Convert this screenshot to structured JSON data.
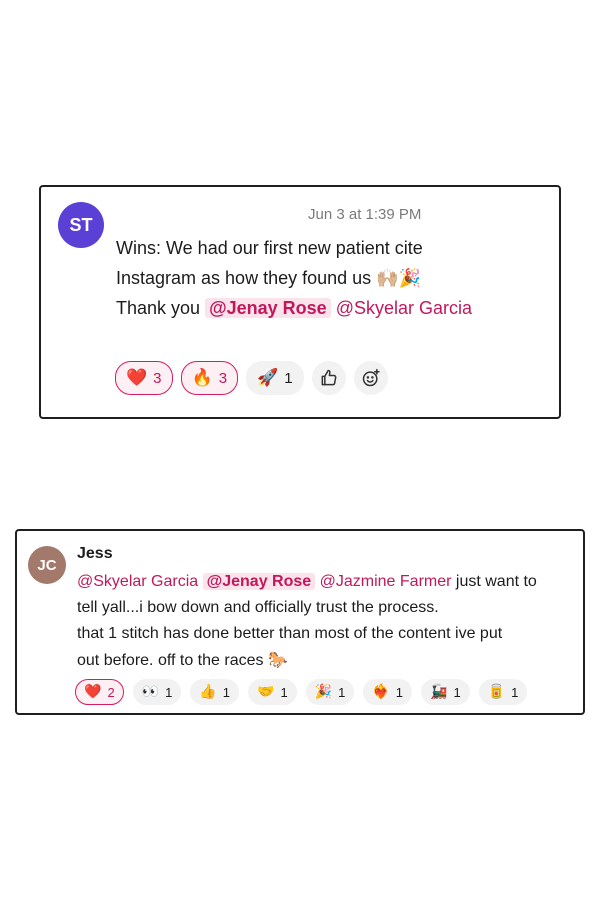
{
  "card1": {
    "avatar_initials": "ST",
    "timestamp": "Jun 3 at 1:39 PM",
    "line1": "Wins: We had our first new patient cite",
    "line2_text": "Instagram as how they found us ",
    "line2_emoji": "🙌🏼🎉",
    "line3_prefix": "Thank you ",
    "mention_jenay": "@Jenay Rose",
    "mention_skyelar": "@Skyelar Garcia",
    "reactions": [
      {
        "emoji": "❤️",
        "count": "3"
      },
      {
        "emoji": "🔥",
        "count": "3"
      },
      {
        "emoji": "🚀",
        "count": "1"
      }
    ],
    "like_icon": "thumbs-up-icon",
    "add_reaction_icon": "add-reaction-icon"
  },
  "card2": {
    "avatar_initials": "JC",
    "author": "Jess",
    "mention_skyelar": "@Skyelar Garcia",
    "mention_jenay": "@Jenay Rose",
    "mention_jazmine": "@Jazmine Farmer",
    "line1_suffix": " just want to",
    "line2": "tell yall...i bow down and officially trust the process.",
    "line3": "that 1 stitch has done better than most of the content ive put",
    "line4_text": "out before. off to the races ",
    "line4_emoji": "🐎",
    "reactions": [
      {
        "emoji": "❤️",
        "count": "2"
      },
      {
        "emoji": "👀",
        "count": "1"
      },
      {
        "emoji": "👍",
        "count": "1"
      },
      {
        "emoji": "🤝",
        "count": "1"
      },
      {
        "emoji": "🎉",
        "count": "1"
      },
      {
        "emoji": "❤️‍🔥",
        "count": "1"
      },
      {
        "emoji": "🚂",
        "count": "1"
      },
      {
        "emoji": "🥫",
        "count": "1"
      }
    ]
  },
  "colors": {
    "mention": "#c2185b",
    "mention_bg": "#fbe3ec",
    "avatar_st": "#5b40d6",
    "avatar_jc": "#a2796a"
  }
}
